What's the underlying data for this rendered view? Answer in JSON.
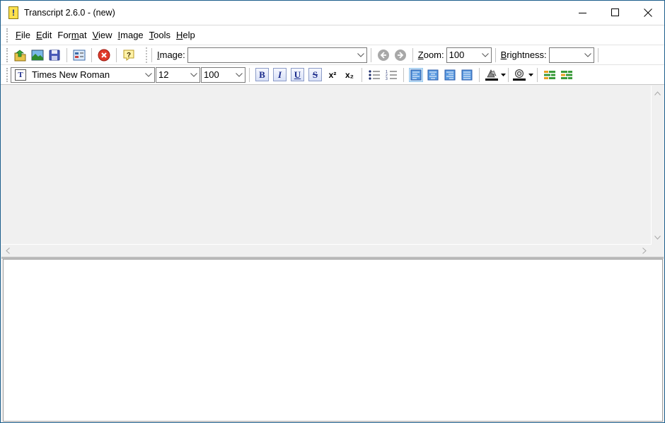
{
  "window": {
    "title": "Transcript  2.6.0 - (new)",
    "app_icon_glyph": "!",
    "controls": {
      "minimize": "minimize-icon",
      "maximize": "maximize-icon",
      "close": "close-icon"
    }
  },
  "menu": {
    "items": [
      {
        "label": "File",
        "mnemonic": "F",
        "rest": "ile"
      },
      {
        "label": "Edit",
        "mnemonic": "E",
        "rest": "dit"
      },
      {
        "label": "Format",
        "pre": "For",
        "mnemonic": "m",
        "rest": "at"
      },
      {
        "label": "View",
        "mnemonic": "V",
        "rest": "iew"
      },
      {
        "label": "Image",
        "mnemonic": "I",
        "rest": "mage"
      },
      {
        "label": "Tools",
        "mnemonic": "T",
        "rest": "ools"
      },
      {
        "label": "Help",
        "mnemonic": "H",
        "rest": "elp"
      }
    ]
  },
  "toolbar1": {
    "buttons": [
      "open-icon",
      "open-image-icon",
      "save-icon",
      "properties-icon",
      "stop-icon",
      "help-icon"
    ],
    "image_label_mnemonic": "I",
    "image_label_rest": "mage:",
    "image_value": "",
    "zoom_label_mnemonic": "Z",
    "zoom_label_rest": "oom:",
    "zoom_value": "100",
    "brightness_label_mnemonic": "B",
    "brightness_label_rest": "rightness:",
    "brightness_value": ""
  },
  "toolbar2": {
    "font_family": "Times New Roman",
    "font_size": "12",
    "scale": "100",
    "format_buttons": [
      {
        "name": "bold",
        "glyph": "B"
      },
      {
        "name": "italic",
        "glyph": "I"
      },
      {
        "name": "underline",
        "glyph": "U"
      },
      {
        "name": "strikethrough",
        "glyph": "S"
      }
    ],
    "superscript_glyph": "x²",
    "subscript_glyph": "x₂",
    "alignment_active": "left"
  },
  "colors": {
    "window_border": "#1c5e8c",
    "active_align_bg": "#cce4f7",
    "canvas_bg": "#f0f0f0",
    "editor_bg": "#ffffff"
  }
}
